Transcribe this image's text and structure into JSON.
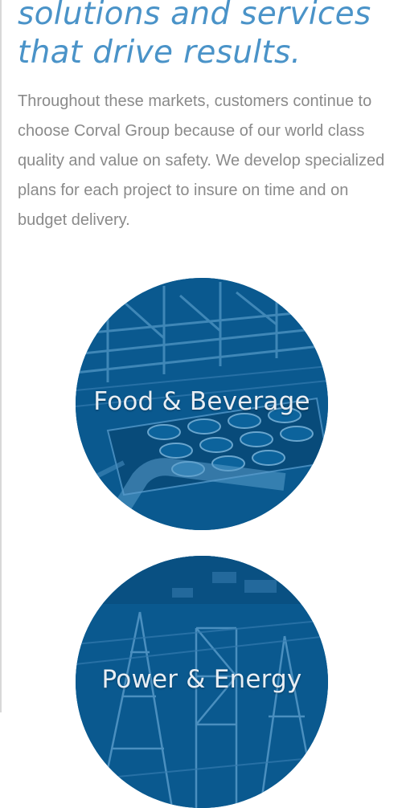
{
  "headline": {
    "line1": "solutions and services",
    "line2": "that drive results."
  },
  "intro": "Throughout these markets, customers continue to choose Corval Group because of our world class quality and value on safety. We develop specialized plans for each project to insure on time and on budget delivery.",
  "industries": [
    {
      "label": "Food & Beverage"
    },
    {
      "label": "Power & Energy"
    }
  ],
  "colors": {
    "headline": "#4a93c8",
    "body_text": "#8a8a8a",
    "circle_tint": "#0a5c93"
  }
}
